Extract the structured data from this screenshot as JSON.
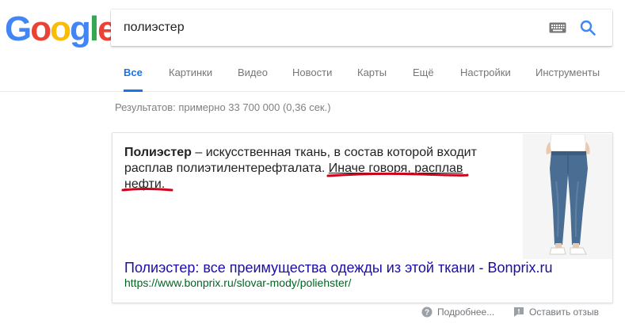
{
  "logo": {
    "letters": [
      "G",
      "o",
      "o",
      "g",
      "l",
      "e"
    ],
    "colors": [
      "#4285f4",
      "#ea4335",
      "#fbbc05",
      "#4285f4",
      "#34a853",
      "#ea4335"
    ]
  },
  "search": {
    "query": "полиэстер",
    "keyboard_icon": "keyboard-icon",
    "search_icon": "search-icon"
  },
  "tabs": [
    {
      "label": "Все",
      "active": true
    },
    {
      "label": "Картинки"
    },
    {
      "label": "Видео"
    },
    {
      "label": "Новости"
    },
    {
      "label": "Карты"
    },
    {
      "label": "Ещё"
    },
    {
      "label": "Настройки"
    },
    {
      "label": "Инструменты"
    }
  ],
  "stats": "Результатов: примерно 33 700 000 (0,36 сек.)",
  "snippet": {
    "bold_term": "Полиэстер",
    "text_1": " – искусственная ткань, в состав которой входит расплав полиэтилентерефталата. ",
    "highlight": "Иначе говоря, расплав нефти.",
    "image_alt": "jeans-photo"
  },
  "result": {
    "title": "Полиэстер: все преимущества одежды из этой ткани - Bonprix.ru",
    "url": "https://www.bonprix.ru/slovar-mody/poliehster/"
  },
  "footer": {
    "more_label": "Подробнее...",
    "feedback_label": "Оставить отзыв"
  },
  "colors": {
    "accent": "#1a73e8",
    "link": "#1a0dab",
    "url": "#006621",
    "annotation": "#d0021b"
  }
}
